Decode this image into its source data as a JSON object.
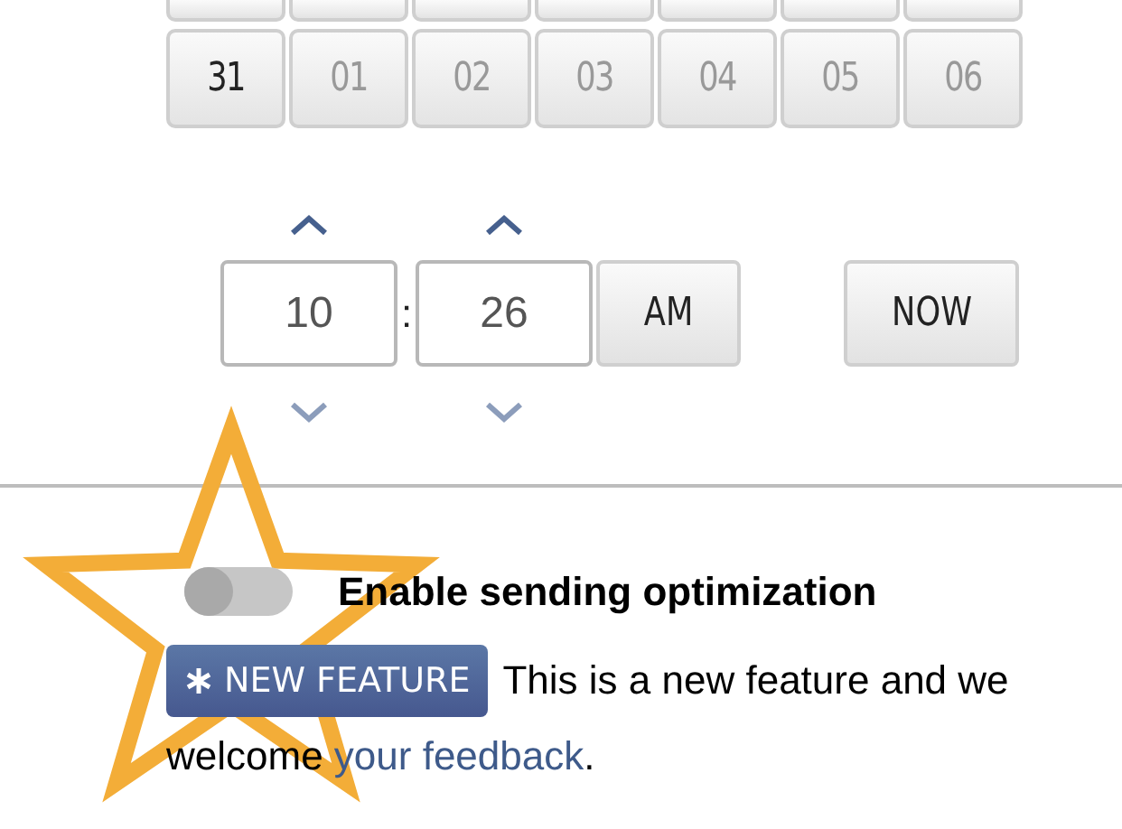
{
  "calendar": {
    "days": [
      {
        "label": "31",
        "current_month": true
      },
      {
        "label": "01",
        "current_month": false
      },
      {
        "label": "02",
        "current_month": false
      },
      {
        "label": "03",
        "current_month": false
      },
      {
        "label": "04",
        "current_month": false
      },
      {
        "label": "05",
        "current_month": false
      },
      {
        "label": "06",
        "current_month": false
      }
    ]
  },
  "time": {
    "hour": "10",
    "separator": ":",
    "minute": "26",
    "period": "AM",
    "now_button": "NOW"
  },
  "optimization": {
    "label": "Enable sending optimization",
    "on": false,
    "badge": "NEW FEATURE",
    "note": "This is a new feature and we",
    "note_continued": "welcome ",
    "link": "your feedback",
    "note_end": "."
  }
}
